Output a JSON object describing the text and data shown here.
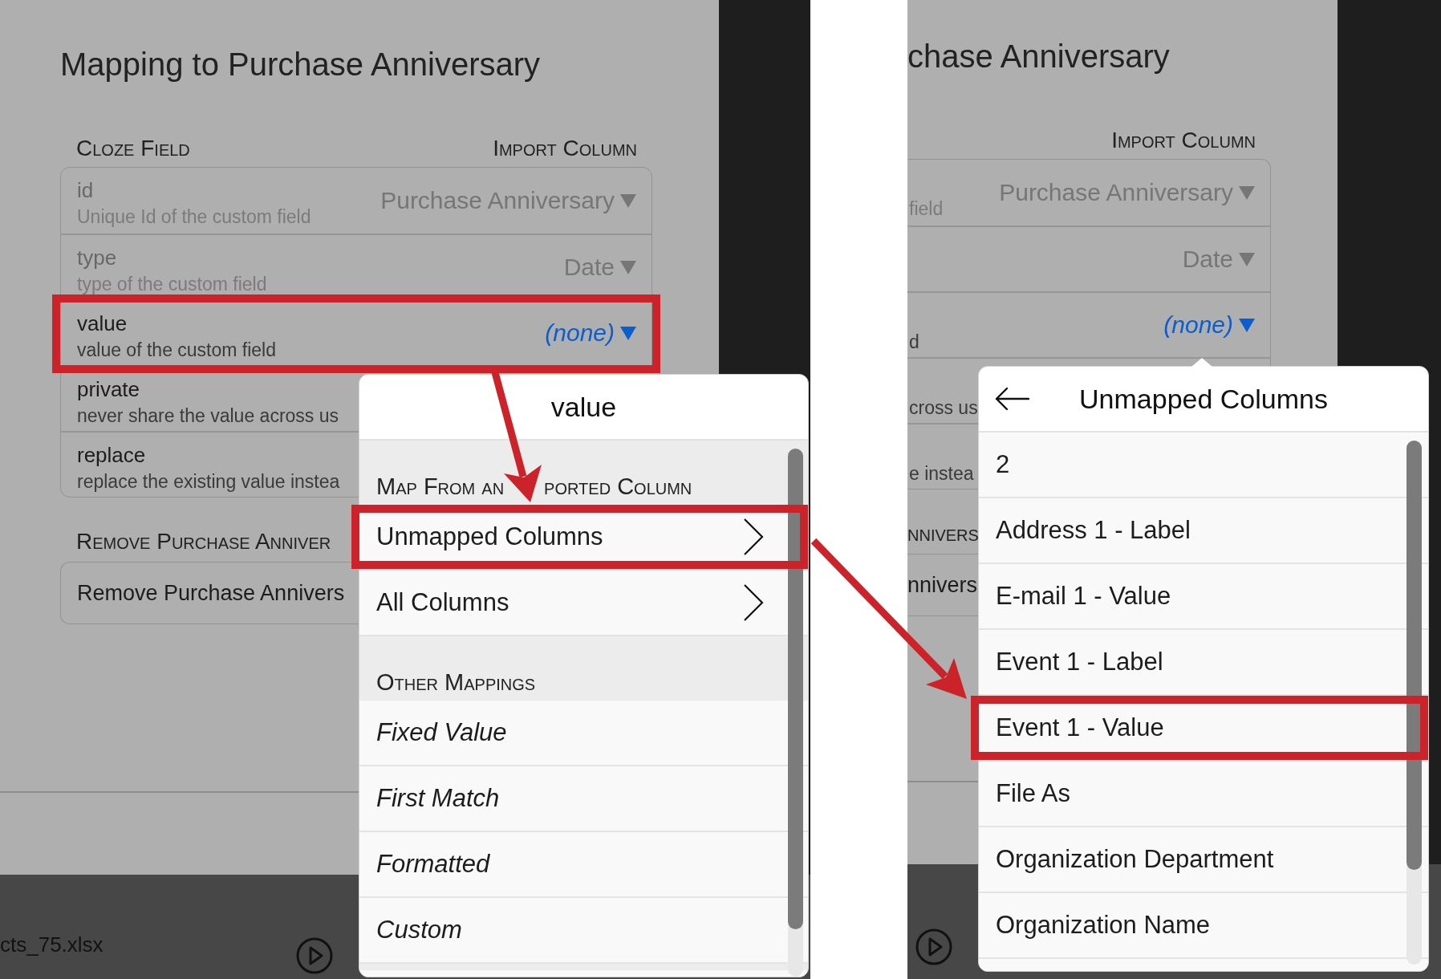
{
  "screenshots": [
    {
      "dialog": {
        "title": "Mapping to Purchase Anniversary",
        "column_headings": {
          "field": "Cloze Field",
          "import": "Import Column"
        },
        "fields": [
          {
            "name": "id",
            "description": "Unique Id of the custom field",
            "mapping": {
              "text": "Purchase Anniversary",
              "mapped": true,
              "selected": false
            },
            "disabled": true,
            "highlighted": false
          },
          {
            "name": "type",
            "description": "type of the custom field",
            "mapping": {
              "text": "Date",
              "mapped": true,
              "selected": false
            },
            "disabled": true,
            "highlighted": false
          },
          {
            "name": "value",
            "description": "value of the custom field",
            "mapping": {
              "text": "(none)",
              "mapped": false,
              "selected": true
            },
            "disabled": false,
            "highlighted": true
          },
          {
            "name": "private",
            "description": "never share the value across us",
            "disabled": false,
            "highlighted": false
          },
          {
            "name": "replace",
            "description": "replace the existing value instea",
            "disabled": false,
            "highlighted": false
          }
        ],
        "remove_section": {
          "heading": "Remove Purchase Anniver",
          "button": "Remove Purchase Annivers"
        }
      },
      "status_bar": {
        "file_name": "cts_75.xlsx"
      },
      "popover": {
        "title": "value",
        "sections": [
          {
            "heading": [
              "Map From an",
              "ported Column"
            ],
            "items": [
              {
                "label": "Unmapped Columns",
                "kind": "submenu",
                "highlighted": true
              },
              {
                "label": "All Columns",
                "kind": "submenu",
                "highlighted": false
              }
            ]
          },
          {
            "heading": [
              "Other Mappings"
            ],
            "items": [
              {
                "label": "Fixed Value",
                "kind": "special",
                "highlighted": false
              },
              {
                "label": "First Match",
                "kind": "special",
                "highlighted": false
              },
              {
                "label": "Formatted",
                "kind": "special",
                "highlighted": false
              },
              {
                "label": "Custom",
                "kind": "special",
                "highlighted": false
              }
            ]
          }
        ]
      }
    },
    {
      "dialog": {
        "title": "chase Anniversary",
        "column_headings": {
          "import": "Import Column"
        },
        "fields": [
          {
            "description": "field",
            "mapping": {
              "text": "Purchase Anniversary",
              "mapped": true,
              "selected": false
            },
            "disabled": true,
            "highlighted": false
          },
          {
            "mapping": {
              "text": "Date",
              "mapped": true,
              "selected": false
            },
            "disabled": true,
            "highlighted": false
          },
          {
            "description": "d",
            "mapping": {
              "text": "(none)",
              "mapped": false,
              "selected": true
            },
            "disabled": false,
            "highlighted": false
          },
          {
            "description": "cross us",
            "disabled": false,
            "highlighted": false
          },
          {
            "description": "e instea",
            "disabled": false,
            "highlighted": false
          }
        ],
        "remove_section": {
          "heading": "nnivers",
          "button": "nnivers"
        }
      },
      "popover": {
        "title": "Unmapped Columns",
        "back_button": true,
        "sections": [
          {
            "items": [
              {
                "label": "2",
                "kind": "column",
                "highlighted": false
              },
              {
                "label": "Address 1 - Label",
                "kind": "column",
                "highlighted": false
              },
              {
                "label": "E-mail 1 - Value",
                "kind": "column",
                "highlighted": false
              },
              {
                "label": "Event 1 - Label",
                "kind": "column",
                "highlighted": false
              },
              {
                "label": "Event 1 - Value",
                "kind": "column",
                "highlighted": true
              },
              {
                "label": "File As",
                "kind": "column",
                "highlighted": false
              },
              {
                "label": "Organization Department",
                "kind": "column",
                "highlighted": false
              },
              {
                "label": "Organization Name",
                "kind": "column",
                "highlighted": false
              }
            ]
          }
        ]
      }
    }
  ]
}
